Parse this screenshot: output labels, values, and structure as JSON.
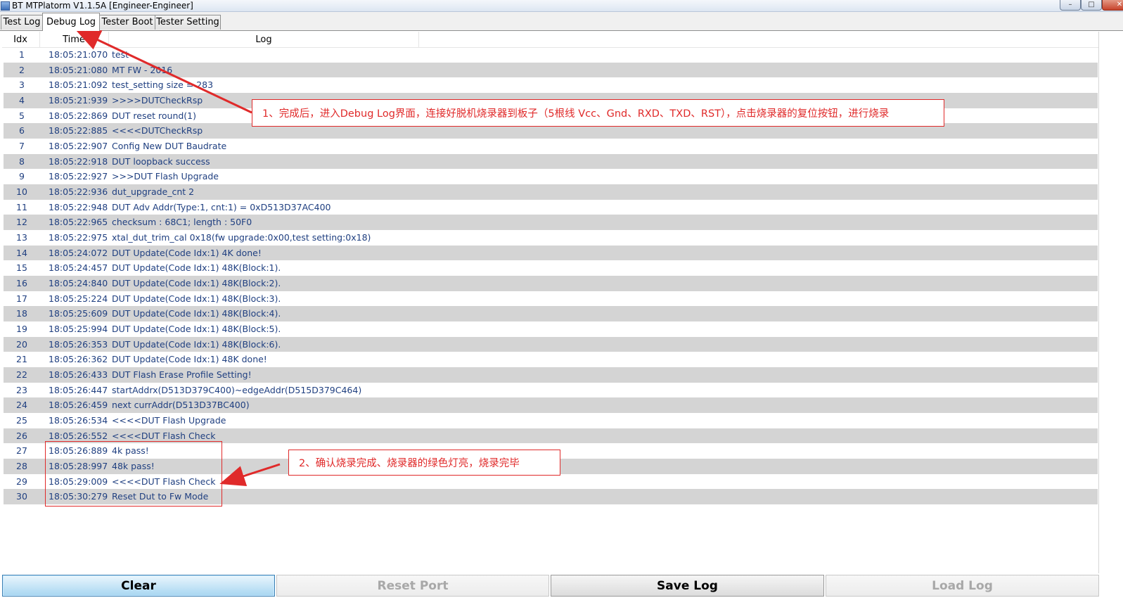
{
  "window": {
    "title": "BT MTPlatorm V1.1.5A [Engineer-Engineer]",
    "controls": {
      "minimize": "–",
      "maximize": "□",
      "close": "✕"
    }
  },
  "tabs": [
    {
      "label": "Test Log",
      "active": false
    },
    {
      "label": "Debug Log",
      "active": true
    },
    {
      "label": "Tester Boot",
      "active": false
    },
    {
      "label": "Tester Setting",
      "active": false
    }
  ],
  "table": {
    "headers": {
      "idx": "Idx",
      "time": "Time",
      "log": "Log"
    },
    "rows": [
      {
        "idx": "1",
        "time": "18:05:21:070",
        "log": "test"
      },
      {
        "idx": "2",
        "time": "18:05:21:080",
        "log": "MT FW - 2016"
      },
      {
        "idx": "3",
        "time": "18:05:21:092",
        "log": "test_setting size = 283"
      },
      {
        "idx": "4",
        "time": "18:05:21:939",
        "log": ">>>>DUTCheckRsp"
      },
      {
        "idx": "5",
        "time": "18:05:22:869",
        "log": "DUT reset round(1)"
      },
      {
        "idx": "6",
        "time": "18:05:22:885",
        "log": "<<<<DUTCheckRsp"
      },
      {
        "idx": "7",
        "time": "18:05:22:907",
        "log": "Config New DUT Baudrate"
      },
      {
        "idx": "8",
        "time": "18:05:22:918",
        "log": "DUT loopback success"
      },
      {
        "idx": "9",
        "time": "18:05:22:927",
        "log": ">>>DUT Flash Upgrade"
      },
      {
        "idx": "10",
        "time": "18:05:22:936",
        "log": "dut_upgrade_cnt  2"
      },
      {
        "idx": "11",
        "time": "18:05:22:948",
        "log": "DUT Adv Addr(Type:1, cnt:1) = 0xD513D37AC400"
      },
      {
        "idx": "12",
        "time": "18:05:22:965",
        "log": "checksum : 68C1; length : 50F0"
      },
      {
        "idx": "13",
        "time": "18:05:22:975",
        "log": "xtal_dut_trim_cal 0x18(fw upgrade:0x00,test setting:0x18)"
      },
      {
        "idx": "14",
        "time": "18:05:24:072",
        "log": "DUT Update(Code Idx:1) 4K done!"
      },
      {
        "idx": "15",
        "time": "18:05:24:457",
        "log": "DUT Update(Code Idx:1) 48K(Block:1)."
      },
      {
        "idx": "16",
        "time": "18:05:24:840",
        "log": "DUT Update(Code Idx:1) 48K(Block:2)."
      },
      {
        "idx": "17",
        "time": "18:05:25:224",
        "log": "DUT Update(Code Idx:1) 48K(Block:3)."
      },
      {
        "idx": "18",
        "time": "18:05:25:609",
        "log": "DUT Update(Code Idx:1) 48K(Block:4)."
      },
      {
        "idx": "19",
        "time": "18:05:25:994",
        "log": "DUT Update(Code Idx:1) 48K(Block:5)."
      },
      {
        "idx": "20",
        "time": "18:05:26:353",
        "log": "DUT Update(Code Idx:1) 48K(Block:6)."
      },
      {
        "idx": "21",
        "time": "18:05:26:362",
        "log": "DUT Update(Code Idx:1) 48K done!"
      },
      {
        "idx": "22",
        "time": "18:05:26:433",
        "log": "DUT Flash Erase Profile Setting!"
      },
      {
        "idx": "23",
        "time": "18:05:26:447",
        "log": "startAddrx(D513D379C400)~edgeAddr(D515D379C464)"
      },
      {
        "idx": "24",
        "time": "18:05:26:459",
        "log": "next currAddr(D513D37BC400)"
      },
      {
        "idx": "25",
        "time": "18:05:26:534",
        "log": "<<<<DUT Flash Upgrade"
      },
      {
        "idx": "26",
        "time": "18:05:26:552",
        "log": "<<<<DUT Flash Check"
      },
      {
        "idx": "27",
        "time": "18:05:26:889",
        "log": "4k pass!"
      },
      {
        "idx": "28",
        "time": "18:05:28:997",
        "log": "48k pass!"
      },
      {
        "idx": "29",
        "time": "18:05:29:009",
        "log": "<<<<DUT Flash Check"
      },
      {
        "idx": "30",
        "time": "18:05:30:279",
        "log": "Reset Dut to Fw Mode"
      }
    ]
  },
  "buttons": {
    "clear": "Clear",
    "reset_port": "Reset Port",
    "save_log": "Save Log",
    "load_log": "Load Log"
  },
  "annotations": {
    "callout1": "1、完成后，进入Debug Log界面，连接好脱机烧录器到板子（5根线 Vcc、Gnd、RXD、TXD、RST），点击烧录器的复位按钮，进行烧录",
    "callout2": "2、确认烧录完成、烧录器的绿色灯亮，烧录完毕",
    "color": "#e02a2a"
  }
}
